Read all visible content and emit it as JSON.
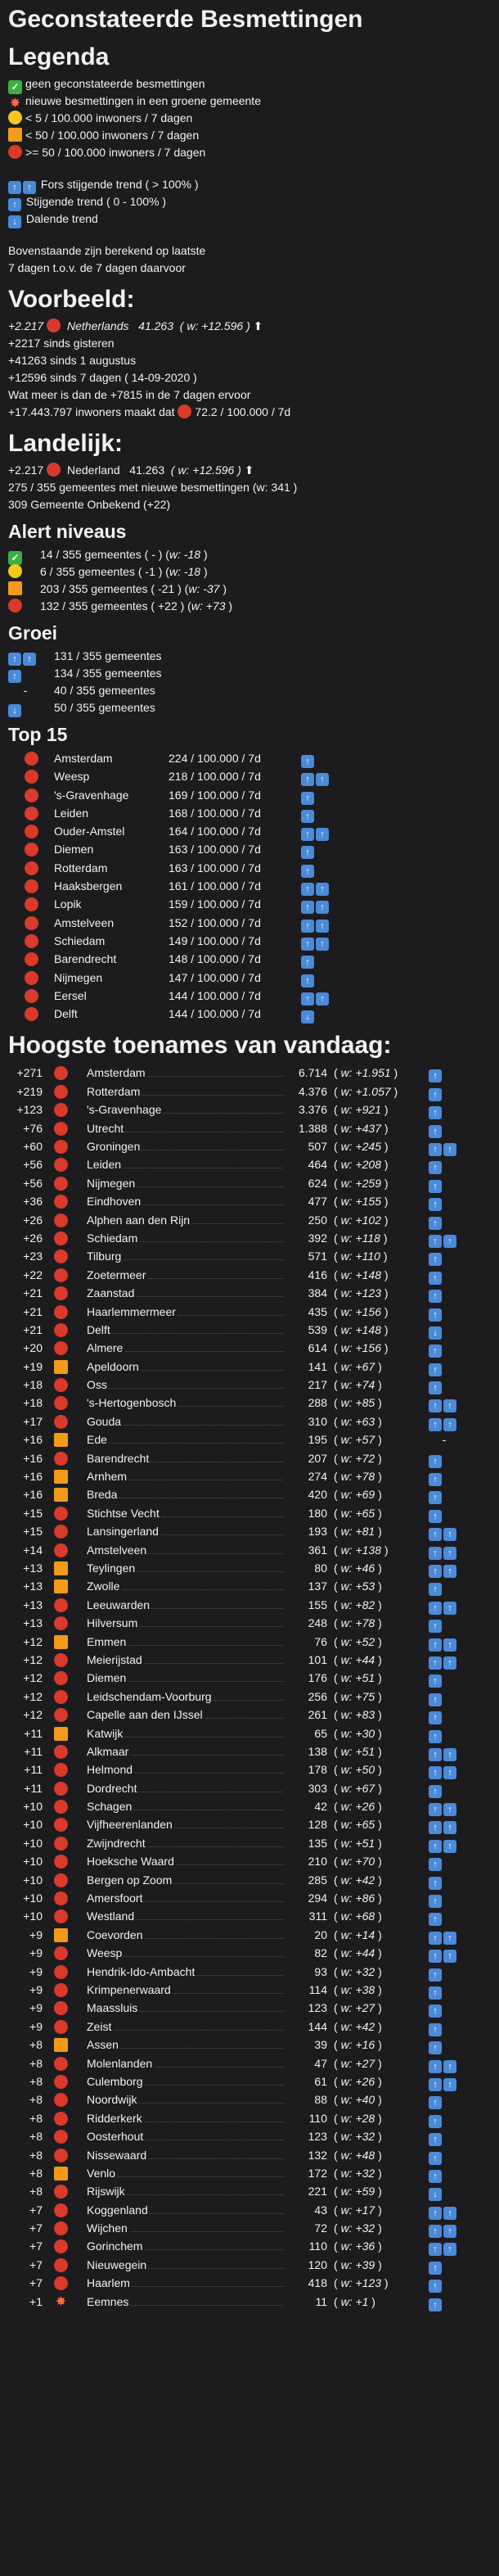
{
  "title": "Geconstateerde Besmettingen",
  "legend": {
    "heading": "Legenda",
    "items": [
      {
        "icon": "check-icon",
        "text": "geen geconstateerde besmettingen"
      },
      {
        "icon": "burst-icon",
        "text": "nieuwe besmettingen in een groene gemeente"
      },
      {
        "icon": "yellow-circle-icon",
        "text": "< 5 / 100.000 inwoners / 7 dagen"
      },
      {
        "icon": "orange-square-icon",
        "text": "< 50 / 100.000 inwoners / 7 dagen"
      },
      {
        "icon": "red-circle-icon",
        "text": ">= 50 / 100.000 inwoners / 7 dagen"
      }
    ],
    "trends": [
      {
        "arrows": "⬆⬆",
        "text": "Fors stijgende trend ( > 100% )"
      },
      {
        "arrows": "⬆",
        "text": "Stijgende trend ( 0 - 100% )"
      },
      {
        "arrows": "⬇",
        "text": "Dalende trend"
      }
    ],
    "note1": "Bovenstaande zijn berekend op laatste",
    "note2": "7 dagen t.o.v. de 7 dagen daarvoor"
  },
  "voorbeeld": {
    "heading": "Voorbeeld:",
    "line_inc": "+2.217",
    "line_name": "Netherlands",
    "line_total": "41.263",
    "line_week": "( w: +12.596 )",
    "trend": "⬆",
    "l2": "+2217 sinds gisteren",
    "l3": "+41263 sinds 1 augustus",
    "l4": "+12596 sinds 7 dagen ( 14-09-2020 )",
    "l5": "Wat meer is dan de +7815 in de 7 dagen ervoor",
    "l6a": "+17.443.797 inwoners maakt dat",
    "l6b": "72.2 / 100.000 / 7d"
  },
  "landelijk": {
    "heading": "Landelijk:",
    "inc": "+2.217",
    "name": "Nederland",
    "total": "41.263",
    "week": "( w: +12.596 )",
    "trend": "⬆",
    "l2": "275 / 355 gemeentes met nieuwe besmettingen (w: 341 )",
    "l3": "309 Gemeente Onbekend (+22)"
  },
  "alert": {
    "heading": "Alert niveaus",
    "rows": [
      {
        "icon": "check-icon",
        "a": "14 / 355 gemeentes ( - ) (",
        "w": "w: -18",
        "b": ")"
      },
      {
        "icon": "yellow-circle-icon",
        "a": "6 / 355 gemeentes ( -1 ) (",
        "w": "w: -18",
        "b": ")"
      },
      {
        "icon": "orange-square-icon",
        "a": "203 / 355 gemeentes ( -21 ) (",
        "w": "w: -37",
        "b": ")"
      },
      {
        "icon": "red-circle-icon",
        "a": "132 / 355 gemeentes ( +22 ) (",
        "w": "w: +73",
        "b": ")"
      }
    ]
  },
  "groei": {
    "heading": "Groei",
    "rows": [
      {
        "arrows": "⬆⬆",
        "text": "131 / 355 gemeentes"
      },
      {
        "arrows": "⬆",
        "text": "134 / 355 gemeentes"
      },
      {
        "arrows": "-",
        "text": "40 / 355 gemeentes"
      },
      {
        "arrows": "⬇",
        "text": "50 / 355 gemeentes"
      }
    ]
  },
  "top15": {
    "heading": "Top 15",
    "rows": [
      {
        "name": "Amsterdam",
        "val": "224 / 100.000 / 7d",
        "tr": "⬆"
      },
      {
        "name": "Weesp",
        "val": "218 / 100.000 / 7d",
        "tr": "⬆⬆"
      },
      {
        "name": "'s-Gravenhage",
        "val": "169 / 100.000 / 7d",
        "tr": "⬆"
      },
      {
        "name": "Leiden",
        "val": "168 / 100.000 / 7d",
        "tr": "⬆"
      },
      {
        "name": "Ouder-Amstel",
        "val": "164 / 100.000 / 7d",
        "tr": "⬆⬆"
      },
      {
        "name": "Diemen",
        "val": "163 / 100.000 / 7d",
        "tr": "⬆"
      },
      {
        "name": "Rotterdam",
        "val": "163 / 100.000 / 7d",
        "tr": "⬆"
      },
      {
        "name": "Haaksbergen",
        "val": "161 / 100.000 / 7d",
        "tr": "⬆⬆"
      },
      {
        "name": "Lopik",
        "val": "159 / 100.000 / 7d",
        "tr": "⬆⬆"
      },
      {
        "name": "Amstelveen",
        "val": "152 / 100.000 / 7d",
        "tr": "⬆⬆"
      },
      {
        "name": "Schiedam",
        "val": "149 / 100.000 / 7d",
        "tr": "⬆⬆"
      },
      {
        "name": "Barendrecht",
        "val": "148 / 100.000 / 7d",
        "tr": "⬆"
      },
      {
        "name": "Nijmegen",
        "val": "147 / 100.000 / 7d",
        "tr": "⬆"
      },
      {
        "name": "Eersel",
        "val": "144 / 100.000 / 7d",
        "tr": "⬆⬆"
      },
      {
        "name": "Delft",
        "val": "144 / 100.000 / 7d",
        "tr": "⬇"
      }
    ]
  },
  "hoogste": {
    "heading": "Hoogste toenames van vandaag:",
    "rows": [
      {
        "inc": "+271",
        "icon": "red",
        "name": "Amsterdam",
        "tot": "6.714",
        "wk": "+1.951",
        "tr": "⬆"
      },
      {
        "inc": "+219",
        "icon": "red",
        "name": "Rotterdam",
        "tot": "4.376",
        "wk": "+1.057",
        "tr": "⬆"
      },
      {
        "inc": "+123",
        "icon": "red",
        "name": "'s-Gravenhage",
        "tot": "3.376",
        "wk": "+921",
        "tr": "⬆"
      },
      {
        "inc": "+76",
        "icon": "red",
        "name": "Utrecht",
        "tot": "1.388",
        "wk": "+437",
        "tr": "⬆"
      },
      {
        "inc": "+60",
        "icon": "red",
        "name": "Groningen",
        "tot": "507",
        "wk": "+245",
        "tr": "⬆⬆"
      },
      {
        "inc": "+56",
        "icon": "red",
        "name": "Leiden",
        "tot": "464",
        "wk": "+208",
        "tr": "⬆"
      },
      {
        "inc": "+56",
        "icon": "red",
        "name": "Nijmegen",
        "tot": "624",
        "wk": "+259",
        "tr": "⬆"
      },
      {
        "inc": "+36",
        "icon": "red",
        "name": "Eindhoven",
        "tot": "477",
        "wk": "+155",
        "tr": "⬆"
      },
      {
        "inc": "+26",
        "icon": "red",
        "name": "Alphen aan den Rijn",
        "tot": "250",
        "wk": "+102",
        "tr": "⬆"
      },
      {
        "inc": "+26",
        "icon": "red",
        "name": "Schiedam",
        "tot": "392",
        "wk": "+118",
        "tr": "⬆⬆"
      },
      {
        "inc": "+23",
        "icon": "red",
        "name": "Tilburg",
        "tot": "571",
        "wk": "+110",
        "tr": "⬆"
      },
      {
        "inc": "+22",
        "icon": "red",
        "name": "Zoetermeer",
        "tot": "416",
        "wk": "+148",
        "tr": "⬆"
      },
      {
        "inc": "+21",
        "icon": "red",
        "name": "Zaanstad",
        "tot": "384",
        "wk": "+123",
        "tr": "⬆"
      },
      {
        "inc": "+21",
        "icon": "red",
        "name": "Haarlemmermeer",
        "tot": "435",
        "wk": "+156",
        "tr": "⬆"
      },
      {
        "inc": "+21",
        "icon": "red",
        "name": "Delft",
        "tot": "539",
        "wk": "+148",
        "tr": "⬇"
      },
      {
        "inc": "+20",
        "icon": "red",
        "name": "Almere",
        "tot": "614",
        "wk": "+156",
        "tr": "⬆"
      },
      {
        "inc": "+19",
        "icon": "orange",
        "name": "Apeldoorn",
        "tot": "141",
        "wk": "+67",
        "tr": "⬆"
      },
      {
        "inc": "+18",
        "icon": "red",
        "name": "Oss",
        "tot": "217",
        "wk": "+74",
        "tr": "⬆"
      },
      {
        "inc": "+18",
        "icon": "red",
        "name": "'s-Hertogenbosch",
        "tot": "288",
        "wk": "+85",
        "tr": "⬆⬆"
      },
      {
        "inc": "+17",
        "icon": "red",
        "name": "Gouda",
        "tot": "310",
        "wk": "+63",
        "tr": "⬆⬆"
      },
      {
        "inc": "+16",
        "icon": "orange",
        "name": "Ede",
        "tot": "195",
        "wk": "+57",
        "tr": "-"
      },
      {
        "inc": "+16",
        "icon": "red",
        "name": "Barendrecht",
        "tot": "207",
        "wk": "+72",
        "tr": "⬆"
      },
      {
        "inc": "+16",
        "icon": "orange",
        "name": "Arnhem",
        "tot": "274",
        "wk": "+78",
        "tr": "⬆"
      },
      {
        "inc": "+16",
        "icon": "orange",
        "name": "Breda",
        "tot": "420",
        "wk": "+69",
        "tr": "⬆"
      },
      {
        "inc": "+15",
        "icon": "red",
        "name": "Stichtse Vecht",
        "tot": "180",
        "wk": "+65",
        "tr": "⬆"
      },
      {
        "inc": "+15",
        "icon": "red",
        "name": "Lansingerland",
        "tot": "193",
        "wk": "+81",
        "tr": "⬆⬆"
      },
      {
        "inc": "+14",
        "icon": "red",
        "name": "Amstelveen",
        "tot": "361",
        "wk": "+138",
        "tr": "⬆⬆"
      },
      {
        "inc": "+13",
        "icon": "orange",
        "name": "Teylingen",
        "tot": "80",
        "wk": "+46",
        "tr": "⬆⬆"
      },
      {
        "inc": "+13",
        "icon": "orange",
        "name": "Zwolle",
        "tot": "137",
        "wk": "+53",
        "tr": "⬆"
      },
      {
        "inc": "+13",
        "icon": "red",
        "name": "Leeuwarden",
        "tot": "155",
        "wk": "+82",
        "tr": "⬆⬆"
      },
      {
        "inc": "+13",
        "icon": "red",
        "name": "Hilversum",
        "tot": "248",
        "wk": "+78",
        "tr": "⬆"
      },
      {
        "inc": "+12",
        "icon": "orange",
        "name": "Emmen",
        "tot": "76",
        "wk": "+52",
        "tr": "⬆⬆"
      },
      {
        "inc": "+12",
        "icon": "red",
        "name": "Meierijstad",
        "tot": "101",
        "wk": "+44",
        "tr": "⬆⬆"
      },
      {
        "inc": "+12",
        "icon": "red",
        "name": "Diemen",
        "tot": "176",
        "wk": "+51",
        "tr": "⬆"
      },
      {
        "inc": "+12",
        "icon": "red",
        "name": "Leidschendam-Voorburg",
        "tot": "256",
        "wk": "+75",
        "tr": "⬆"
      },
      {
        "inc": "+12",
        "icon": "red",
        "name": "Capelle aan den IJssel",
        "tot": "261",
        "wk": "+83",
        "tr": "⬆"
      },
      {
        "inc": "+11",
        "icon": "orange",
        "name": "Katwijk",
        "tot": "65",
        "wk": "+30",
        "tr": "⬆"
      },
      {
        "inc": "+11",
        "icon": "red",
        "name": "Alkmaar",
        "tot": "138",
        "wk": "+51",
        "tr": "⬆⬆"
      },
      {
        "inc": "+11",
        "icon": "red",
        "name": "Helmond",
        "tot": "178",
        "wk": "+50",
        "tr": "⬆⬆"
      },
      {
        "inc": "+11",
        "icon": "red",
        "name": "Dordrecht",
        "tot": "303",
        "wk": "+67",
        "tr": "⬆"
      },
      {
        "inc": "+10",
        "icon": "red",
        "name": "Schagen",
        "tot": "42",
        "wk": "+26",
        "tr": "⬆⬆"
      },
      {
        "inc": "+10",
        "icon": "red",
        "name": "Vijfheerenlanden",
        "tot": "128",
        "wk": "+65",
        "tr": "⬆⬆"
      },
      {
        "inc": "+10",
        "icon": "red",
        "name": "Zwijndrecht",
        "tot": "135",
        "wk": "+51",
        "tr": "⬆⬆"
      },
      {
        "inc": "+10",
        "icon": "red",
        "name": "Hoeksche Waard",
        "tot": "210",
        "wk": "+70",
        "tr": "⬆"
      },
      {
        "inc": "+10",
        "icon": "red",
        "name": "Bergen op Zoom",
        "tot": "285",
        "wk": "+42",
        "tr": "⬆"
      },
      {
        "inc": "+10",
        "icon": "red",
        "name": "Amersfoort",
        "tot": "294",
        "wk": "+86",
        "tr": "⬆"
      },
      {
        "inc": "+10",
        "icon": "red",
        "name": "Westland",
        "tot": "311",
        "wk": "+68",
        "tr": "⬆"
      },
      {
        "inc": "+9",
        "icon": "orange",
        "name": "Coevorden",
        "tot": "20",
        "wk": "+14",
        "tr": "⬆⬆"
      },
      {
        "inc": "+9",
        "icon": "red",
        "name": "Weesp",
        "tot": "82",
        "wk": "+44",
        "tr": "⬆⬆"
      },
      {
        "inc": "+9",
        "icon": "red",
        "name": "Hendrik-Ido-Ambacht",
        "tot": "93",
        "wk": "+32",
        "tr": "⬆"
      },
      {
        "inc": "+9",
        "icon": "red",
        "name": "Krimpenerwaard",
        "tot": "114",
        "wk": "+38",
        "tr": "⬆"
      },
      {
        "inc": "+9",
        "icon": "red",
        "name": "Maassluis",
        "tot": "123",
        "wk": "+27",
        "tr": "⬆"
      },
      {
        "inc": "+9",
        "icon": "red",
        "name": "Zeist",
        "tot": "144",
        "wk": "+42",
        "tr": "⬆"
      },
      {
        "inc": "+8",
        "icon": "orange",
        "name": "Assen",
        "tot": "39",
        "wk": "+16",
        "tr": "⬆"
      },
      {
        "inc": "+8",
        "icon": "red",
        "name": "Molenlanden",
        "tot": "47",
        "wk": "+27",
        "tr": "⬆⬆"
      },
      {
        "inc": "+8",
        "icon": "red",
        "name": "Culemborg",
        "tot": "61",
        "wk": "+26",
        "tr": "⬆⬆"
      },
      {
        "inc": "+8",
        "icon": "red",
        "name": "Noordwijk",
        "tot": "88",
        "wk": "+40",
        "tr": "⬆"
      },
      {
        "inc": "+8",
        "icon": "red",
        "name": "Ridderkerk",
        "tot": "110",
        "wk": "+28",
        "tr": "⬆"
      },
      {
        "inc": "+8",
        "icon": "red",
        "name": "Oosterhout",
        "tot": "123",
        "wk": "+32",
        "tr": "⬆"
      },
      {
        "inc": "+8",
        "icon": "red",
        "name": "Nissewaard",
        "tot": "132",
        "wk": "+48",
        "tr": "⬆"
      },
      {
        "inc": "+8",
        "icon": "orange",
        "name": "Venlo",
        "tot": "172",
        "wk": "+32",
        "tr": "⬆"
      },
      {
        "inc": "+8",
        "icon": "red",
        "name": "Rijswijk",
        "tot": "221",
        "wk": "+59",
        "tr": "⬇"
      },
      {
        "inc": "+7",
        "icon": "red",
        "name": "Koggenland",
        "tot": "43",
        "wk": "+17",
        "tr": "⬆⬆"
      },
      {
        "inc": "+7",
        "icon": "red",
        "name": "Wijchen",
        "tot": "72",
        "wk": "+32",
        "tr": "⬆⬆"
      },
      {
        "inc": "+7",
        "icon": "red",
        "name": "Gorinchem",
        "tot": "110",
        "wk": "+36",
        "tr": "⬆⬆"
      },
      {
        "inc": "+7",
        "icon": "red",
        "name": "Nieuwegein",
        "tot": "120",
        "wk": "+39",
        "tr": "⬆"
      },
      {
        "inc": "+7",
        "icon": "red",
        "name": "Haarlem",
        "tot": "418",
        "wk": "+123",
        "tr": "⬆"
      },
      {
        "inc": "+1",
        "icon": "burst",
        "name": "Eemnes",
        "tot": "11",
        "wk": "+1",
        "tr": "⬆"
      }
    ]
  },
  "colors": {
    "background": "#1c1c1e",
    "text": "#f2f2f2",
    "red": "#d93a2b",
    "orange": "#f29a1a",
    "yellow": "#f7c71b",
    "green": "#3cb043",
    "arrow": "#4a8ad9"
  }
}
